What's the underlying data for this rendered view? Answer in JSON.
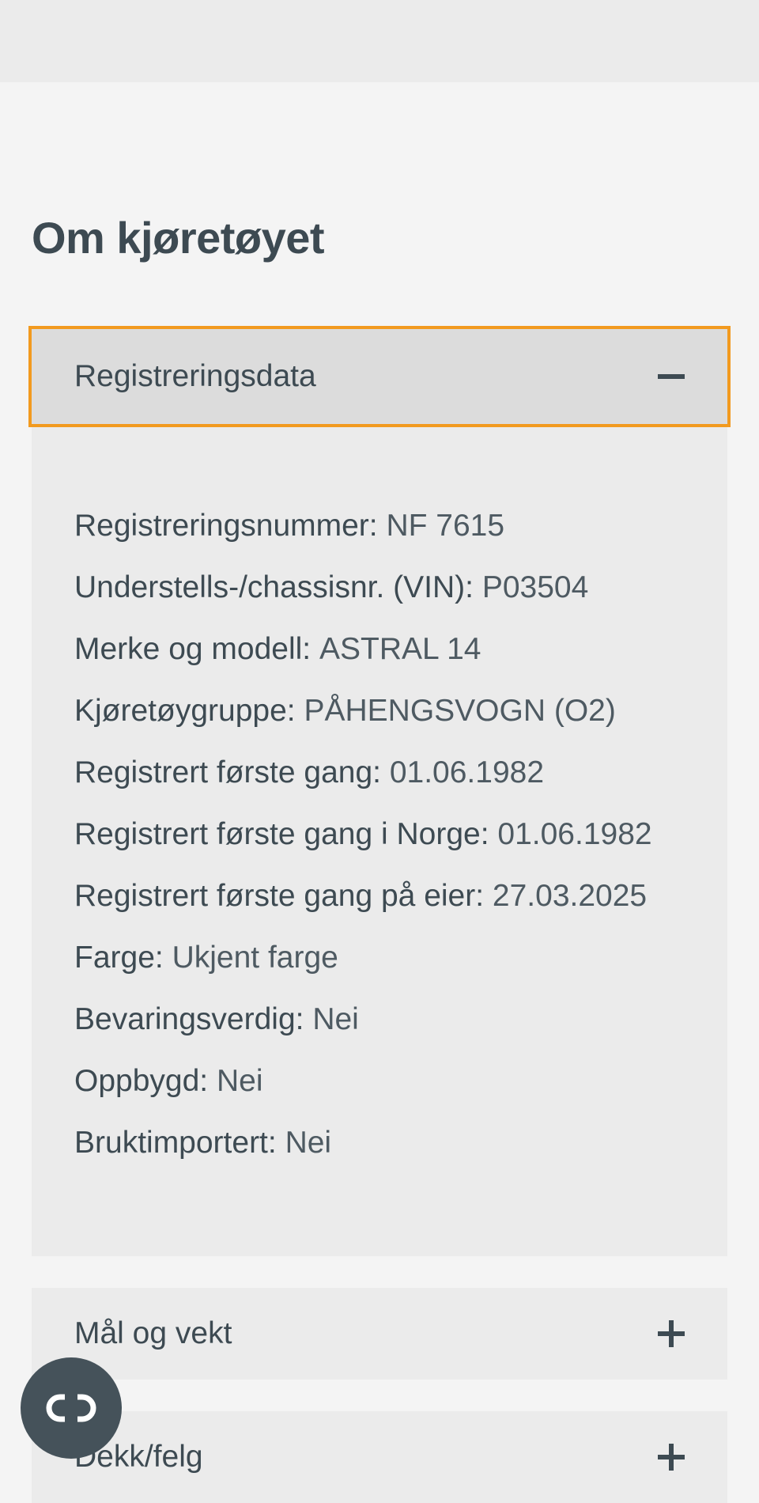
{
  "section": {
    "title": "Om kjøretøyet"
  },
  "accordion": {
    "registration": {
      "label": "Registreringsdata",
      "expanded": true,
      "rows": [
        {
          "key": "Registreringsnummer:",
          "value": "NF 7615"
        },
        {
          "key": "Understells-/chassisnr. (VIN):",
          "value": "P03504"
        },
        {
          "key": "Merke og modell:",
          "value": "ASTRAL 14"
        },
        {
          "key": "Kjøretøygruppe:",
          "value": "PÅHENGSVOGN (O2)"
        },
        {
          "key": "Registrert første gang:",
          "value": "01.06.1982"
        },
        {
          "key": "Registrert første gang i Norge:",
          "value": "01.06.1982"
        },
        {
          "key": "Registrert første gang på eier:",
          "value": "27.03.2025"
        },
        {
          "key": "Farge:",
          "value": "Ukjent farge"
        },
        {
          "key": "Bevaringsverdig:",
          "value": "Nei"
        },
        {
          "key": "Oppbygd:",
          "value": "Nei"
        },
        {
          "key": "Bruktimportert:",
          "value": "Nei"
        }
      ]
    },
    "measurements": {
      "label": "Mål og vekt",
      "expanded": false
    },
    "tires": {
      "label": "Dekk/felg",
      "expanded": false
    }
  },
  "icons": {
    "collapse": "minus-icon",
    "expand": "plus-icon",
    "fab": "link-icon"
  },
  "colors": {
    "focus_outline": "#f29a1f",
    "text": "#3d4a52",
    "fab_background": "#45525a"
  }
}
